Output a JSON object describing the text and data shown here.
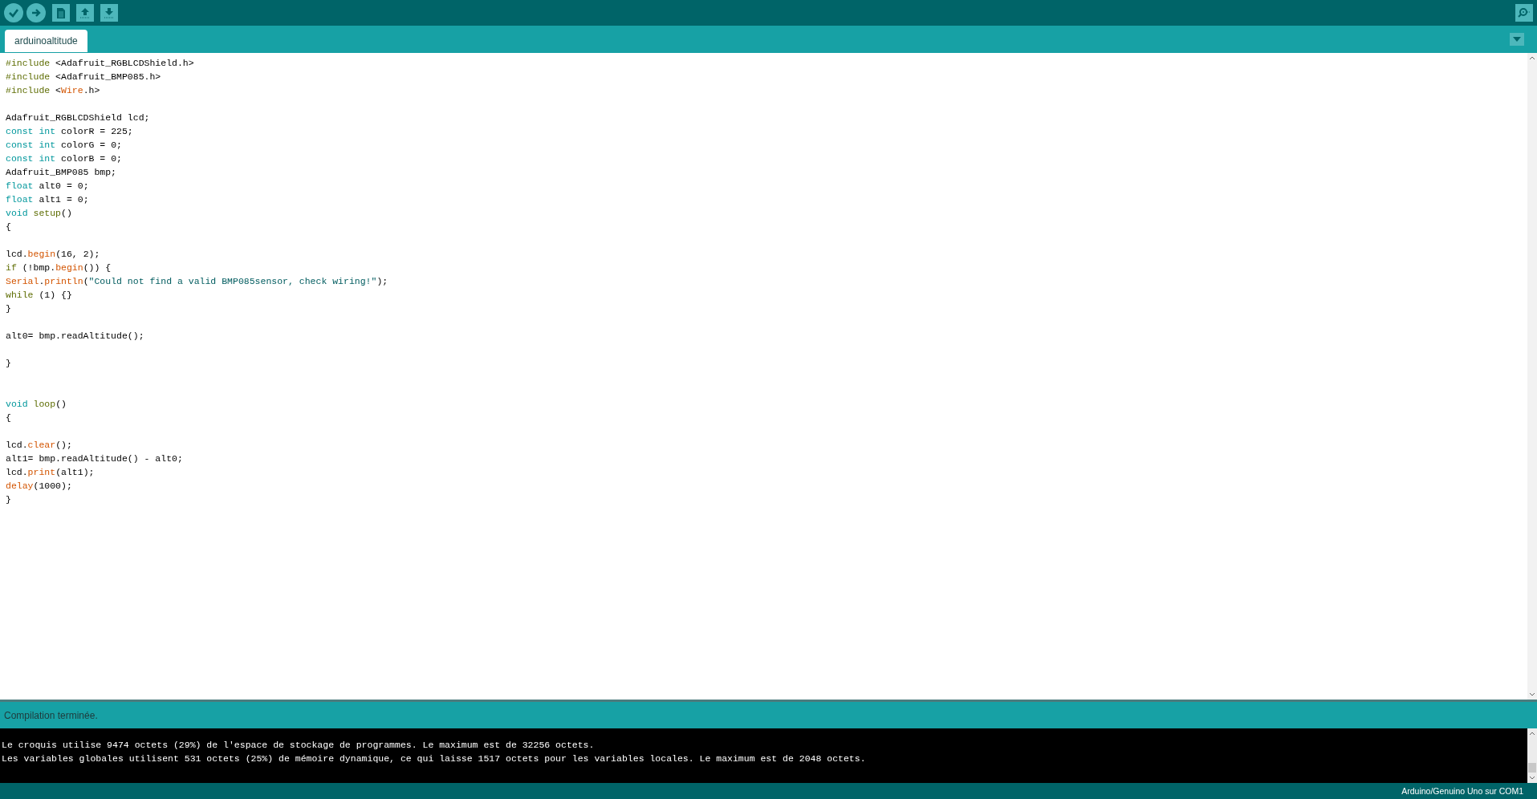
{
  "toolbar": {
    "buttons": [
      {
        "kind": "verify"
      },
      {
        "kind": "upload"
      },
      {
        "kind": "new"
      },
      {
        "kind": "open"
      },
      {
        "kind": "save"
      }
    ]
  },
  "tabs": [
    {
      "label": "arduinoaltitude",
      "selected": true
    }
  ],
  "editor": {
    "lines": [
      {
        "tokens": [
          {
            "text": "#include",
            "kind": "preproc"
          },
          {
            "text": " <Adafruit_RGBLCDShield.h>",
            "kind": "plain"
          }
        ]
      },
      {
        "tokens": [
          {
            "text": "#include",
            "kind": "preproc"
          },
          {
            "text": " <Adafruit_BMP085.h>",
            "kind": "plain"
          }
        ]
      },
      {
        "tokens": [
          {
            "text": "#include",
            "kind": "preproc"
          },
          {
            "text": " <",
            "kind": "plain"
          },
          {
            "text": "Wire",
            "kind": "function"
          },
          {
            "text": ".h>",
            "kind": "plain"
          }
        ]
      },
      {
        "blank": true
      },
      {
        "tokens": [
          {
            "text": "Adafruit_RGBLCDShield lcd;",
            "kind": "plain"
          }
        ]
      },
      {
        "tokens": [
          {
            "text": "const int",
            "kind": "keyword"
          },
          {
            "text": " colorR = 225;",
            "kind": "plain"
          }
        ]
      },
      {
        "tokens": [
          {
            "text": "const int",
            "kind": "keyword"
          },
          {
            "text": " colorG = 0;",
            "kind": "plain"
          }
        ]
      },
      {
        "tokens": [
          {
            "text": "const int",
            "kind": "keyword"
          },
          {
            "text": " colorB = 0;",
            "kind": "plain"
          }
        ]
      },
      {
        "tokens": [
          {
            "text": "Adafruit_BMP085 bmp;",
            "kind": "plain"
          }
        ]
      },
      {
        "tokens": [
          {
            "text": "float",
            "kind": "keyword"
          },
          {
            "text": " alt0 = 0;",
            "kind": "plain"
          }
        ]
      },
      {
        "tokens": [
          {
            "text": "float",
            "kind": "keyword"
          },
          {
            "text": " alt1 = 0;",
            "kind": "plain"
          }
        ]
      },
      {
        "tokens": [
          {
            "text": "void",
            "kind": "keyword"
          },
          {
            "text": " setup",
            "kind": "preproc"
          },
          {
            "text": "()",
            "kind": "plain"
          }
        ]
      },
      {
        "tokens": [
          {
            "text": "{",
            "kind": "plain"
          }
        ]
      },
      {
        "blank": true
      },
      {
        "tokens": [
          {
            "text": "lcd.",
            "kind": "plain"
          },
          {
            "text": "begin",
            "kind": "function"
          },
          {
            "text": "(16, 2);",
            "kind": "plain"
          }
        ]
      },
      {
        "tokens": [
          {
            "text": "if",
            "kind": "preproc"
          },
          {
            "text": " (!bmp.",
            "kind": "plain"
          },
          {
            "text": "begin",
            "kind": "function"
          },
          {
            "text": "()) {",
            "kind": "plain"
          }
        ]
      },
      {
        "tokens": [
          {
            "text": "Serial",
            "kind": "class"
          },
          {
            "text": ".",
            "kind": "plain"
          },
          {
            "text": "println",
            "kind": "function"
          },
          {
            "text": "(",
            "kind": "plain"
          },
          {
            "text": "\"Could not find a valid BMP085sensor, check wiring!\"",
            "kind": "string"
          },
          {
            "text": ");",
            "kind": "plain"
          }
        ]
      },
      {
        "tokens": [
          {
            "text": "while",
            "kind": "preproc"
          },
          {
            "text": " (1) {}",
            "kind": "plain"
          }
        ]
      },
      {
        "tokens": [
          {
            "text": "}",
            "kind": "plain"
          }
        ]
      },
      {
        "blank": true
      },
      {
        "tokens": [
          {
            "text": "alt0= bmp.readAltitude();",
            "kind": "plain"
          }
        ]
      },
      {
        "blank": true
      },
      {
        "tokens": [
          {
            "text": "}",
            "kind": "plain"
          }
        ]
      },
      {
        "blank": true
      },
      {
        "blank": true
      },
      {
        "tokens": [
          {
            "text": "void",
            "kind": "keyword"
          },
          {
            "text": " loop",
            "kind": "preproc"
          },
          {
            "text": "()",
            "kind": "plain"
          }
        ]
      },
      {
        "tokens": [
          {
            "text": "{",
            "kind": "plain"
          }
        ]
      },
      {
        "blank": true
      },
      {
        "tokens": [
          {
            "text": "lcd.",
            "kind": "plain"
          },
          {
            "text": "clear",
            "kind": "function"
          },
          {
            "text": "();",
            "kind": "plain"
          }
        ]
      },
      {
        "tokens": [
          {
            "text": "alt1= bmp.readAltitude() - alt0;",
            "kind": "plain"
          }
        ]
      },
      {
        "tokens": [
          {
            "text": "lcd.",
            "kind": "plain"
          },
          {
            "text": "print",
            "kind": "function"
          },
          {
            "text": "(alt1);",
            "kind": "plain"
          }
        ]
      },
      {
        "tokens": [
          {
            "text": "delay",
            "kind": "function"
          },
          {
            "text": "(1000);",
            "kind": "plain"
          }
        ]
      },
      {
        "tokens": [
          {
            "text": "}",
            "kind": "plain"
          }
        ]
      }
    ]
  },
  "status": {
    "message": "Compilation terminée."
  },
  "console": {
    "lines": [
      "Le croquis utilise 9474 octets (29%) de l'espace de stockage de programmes. Le maximum est de 32256 octets.",
      "Les variables globales utilisent 531 octets (25%) de mémoire dynamique, ce qui laisse 1517 octets pour les variables locales. Le maximum est de 2048 octets."
    ]
  },
  "status_bar": {
    "board": "Arduino/Genuino Uno sur COM1"
  }
}
